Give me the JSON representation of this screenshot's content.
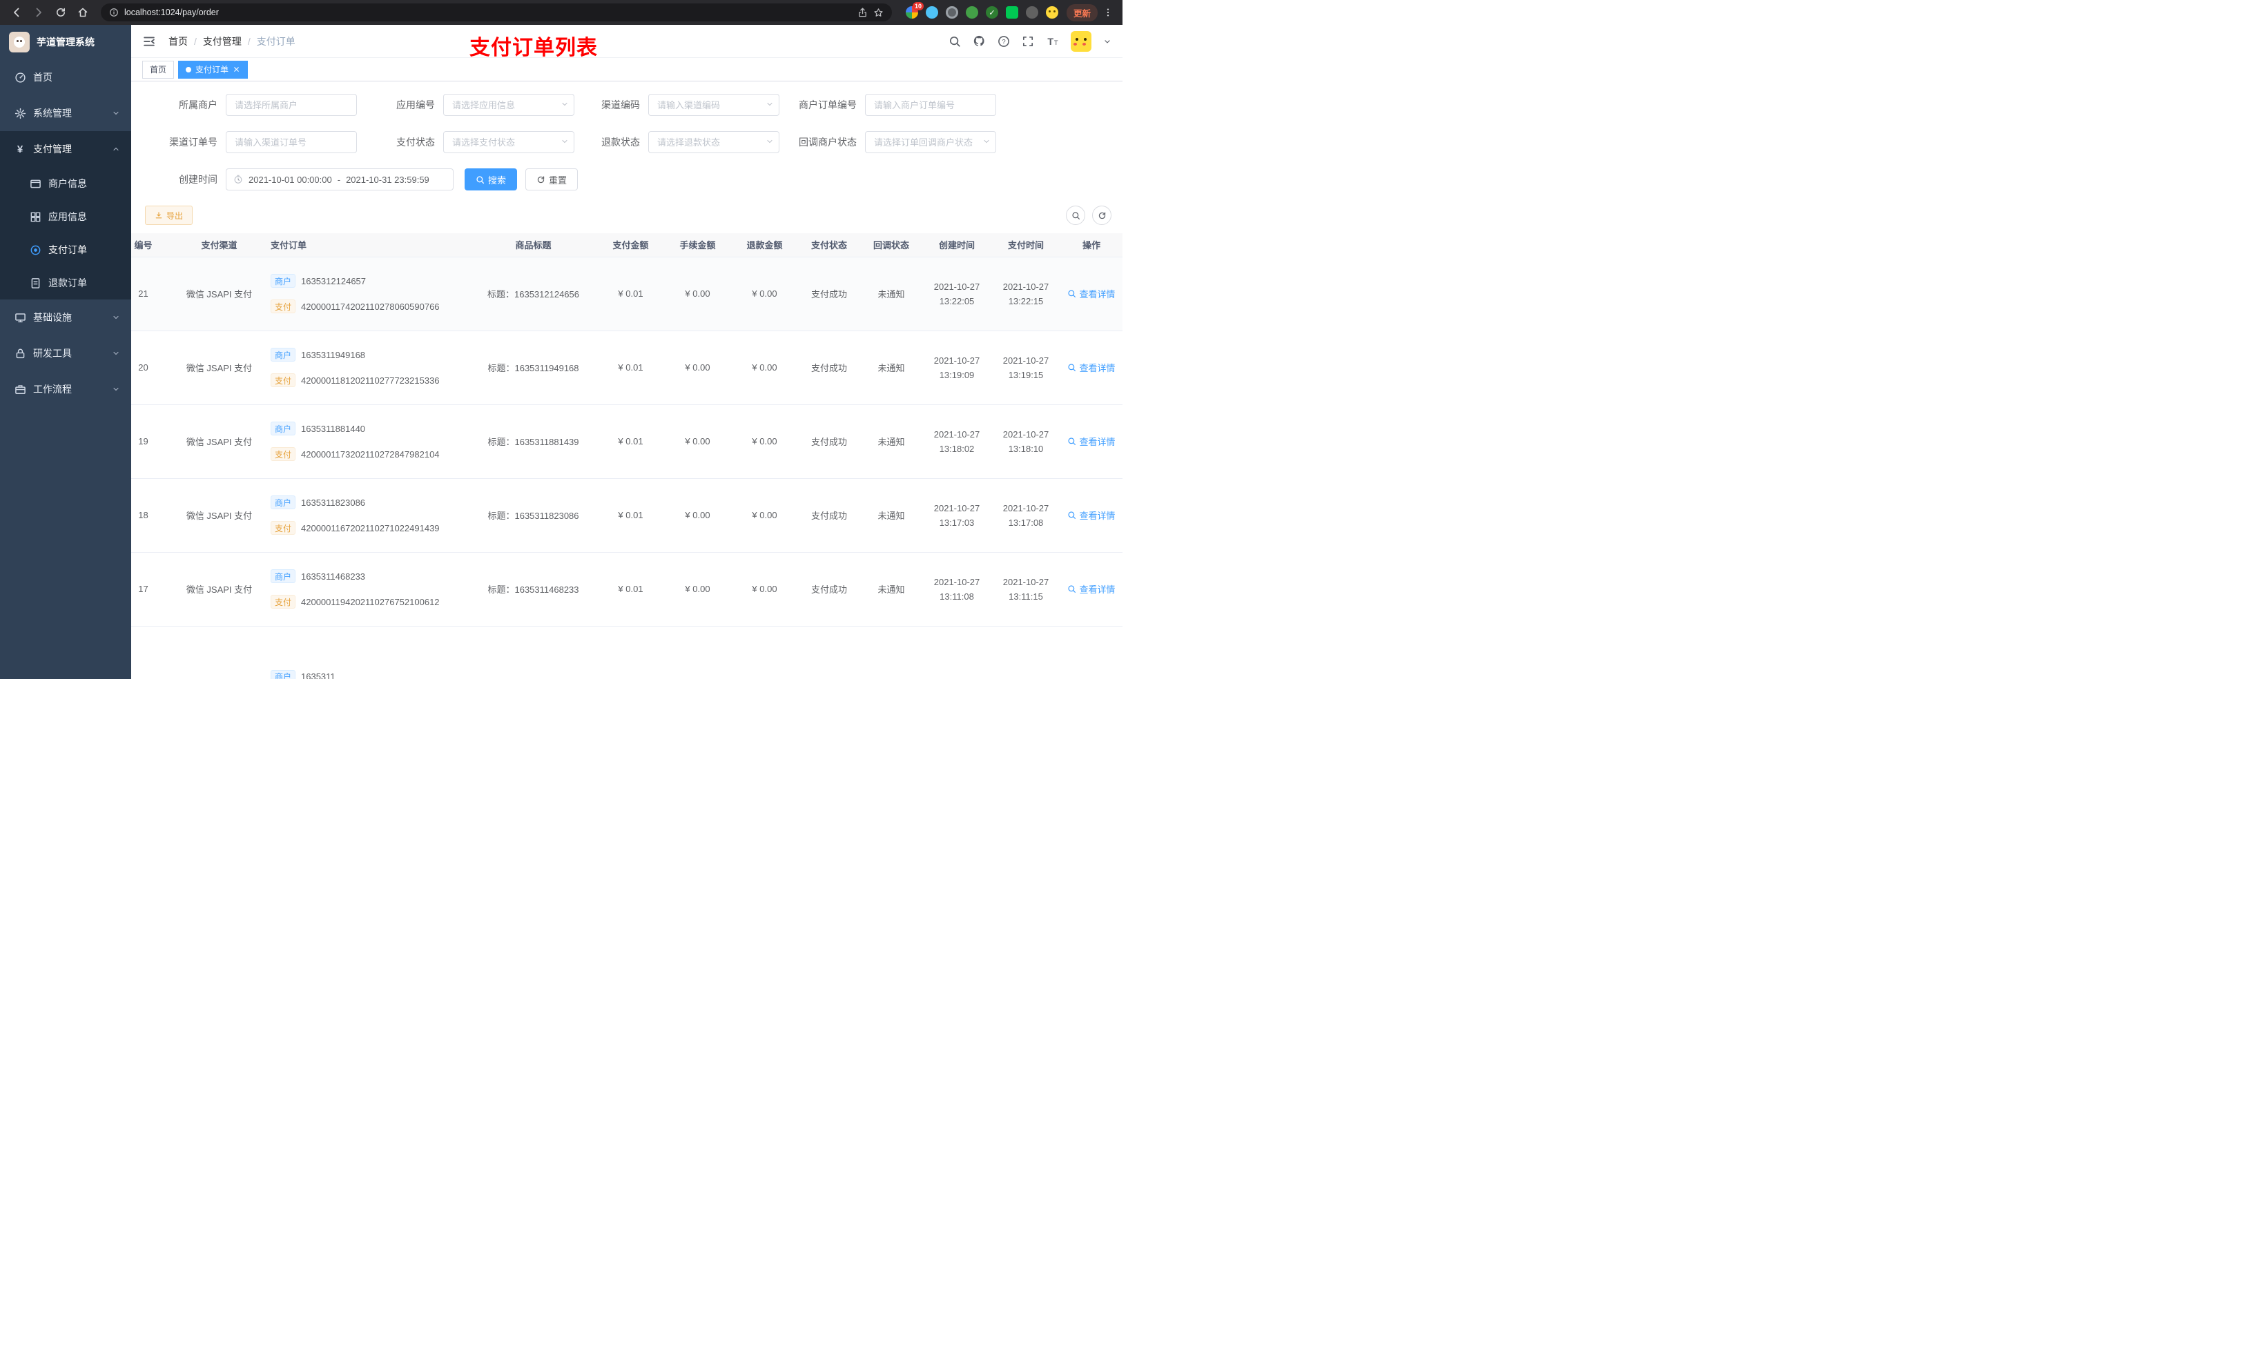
{
  "browser": {
    "url": "localhost:1024/pay/order",
    "ext_badge": "10",
    "update_label": "更新"
  },
  "sidebar": {
    "title": "芋道管理系统",
    "menu": {
      "home": "首页",
      "system": "系统管理",
      "payment": "支付管理",
      "merchant_info": "商户信息",
      "app_info": "应用信息",
      "pay_order": "支付订单",
      "refund_order": "退款订单",
      "infrastructure": "基础设施",
      "dev_tools": "研发工具",
      "workflow": "工作流程"
    }
  },
  "header": {
    "breadcrumb": [
      "首页",
      "支付管理",
      "支付订单"
    ],
    "separator": "/",
    "annotation": "支付订单列表"
  },
  "tabs": {
    "home": "首页",
    "current": "支付订单"
  },
  "filters": {
    "fields": [
      {
        "label": "所属商户",
        "placeholder": "请选择所属商户"
      },
      {
        "label": "应用编号",
        "placeholder": "请选择应用信息"
      },
      {
        "label": "渠道编码",
        "placeholder": "请输入渠道编码"
      },
      {
        "label": "商户订单编号",
        "placeholder": "请输入商户订单编号"
      },
      {
        "label": "渠道订单号",
        "placeholder": "请输入渠道订单号"
      },
      {
        "label": "支付状态",
        "placeholder": "请选择支付状态"
      },
      {
        "label": "退款状态",
        "placeholder": "请选择退款状态"
      },
      {
        "label": "回调商户状态",
        "placeholder": "请选择订单回调商户状态"
      }
    ],
    "date": {
      "label": "创建时间",
      "start": "2021-10-01 00:00:00",
      "separator": "-",
      "end": "2021-10-31 23:59:59"
    },
    "search_label": "搜索",
    "reset_label": "重置"
  },
  "toolbar": {
    "export_label": "导出"
  },
  "table": {
    "columns": [
      "编号",
      "支付渠道",
      "支付订单",
      "商品标题",
      "支付金额",
      "手续金额",
      "退款金额",
      "支付状态",
      "回调状态",
      "创建时间",
      "支付时间",
      "操作"
    ],
    "tag_merchant": "商户",
    "tag_pay": "支付",
    "title_prefix": "标题：",
    "action_label": "查看详情",
    "rows": [
      {
        "id": "21",
        "channel": "微信 JSAPI 支付",
        "merchant_no": "1635312124657",
        "pay_no": "4200001174202110278060590766",
        "title": "1635312124656",
        "amount": "¥ 0.01",
        "fee": "¥ 0.00",
        "refund": "¥ 0.00",
        "status": "支付成功",
        "notify": "未通知",
        "create_date": "2021-10-27",
        "create_time": "13:22:05",
        "pay_date": "2021-10-27",
        "pay_time": "13:22:15"
      },
      {
        "id": "20",
        "channel": "微信 JSAPI 支付",
        "merchant_no": "1635311949168",
        "pay_no": "4200001181202110277723215336",
        "title": "1635311949168",
        "amount": "¥ 0.01",
        "fee": "¥ 0.00",
        "refund": "¥ 0.00",
        "status": "支付成功",
        "notify": "未通知",
        "create_date": "2021-10-27",
        "create_time": "13:19:09",
        "pay_date": "2021-10-27",
        "pay_time": "13:19:15"
      },
      {
        "id": "19",
        "channel": "微信 JSAPI 支付",
        "merchant_no": "1635311881440",
        "pay_no": "4200001173202110272847982104",
        "title": "1635311881439",
        "amount": "¥ 0.01",
        "fee": "¥ 0.00",
        "refund": "¥ 0.00",
        "status": "支付成功",
        "notify": "未通知",
        "create_date": "2021-10-27",
        "create_time": "13:18:02",
        "pay_date": "2021-10-27",
        "pay_time": "13:18:10"
      },
      {
        "id": "18",
        "channel": "微信 JSAPI 支付",
        "merchant_no": "1635311823086",
        "pay_no": "4200001167202110271022491439",
        "title": "1635311823086",
        "amount": "¥ 0.01",
        "fee": "¥ 0.00",
        "refund": "¥ 0.00",
        "status": "支付成功",
        "notify": "未通知",
        "create_date": "2021-10-27",
        "create_time": "13:17:03",
        "pay_date": "2021-10-27",
        "pay_time": "13:17:08"
      },
      {
        "id": "17",
        "channel": "微信 JSAPI 支付",
        "merchant_no": "1635311468233",
        "pay_no": "4200001194202110276752100612",
        "title": "1635311468233",
        "amount": "¥ 0.01",
        "fee": "¥ 0.00",
        "refund": "¥ 0.00",
        "status": "支付成功",
        "notify": "未通知",
        "create_date": "2021-10-27",
        "create_time": "13:11:08",
        "pay_date": "2021-10-27",
        "pay_time": "13:11:15"
      }
    ],
    "partial_row": {
      "merchant_no": "1635311"
    }
  }
}
